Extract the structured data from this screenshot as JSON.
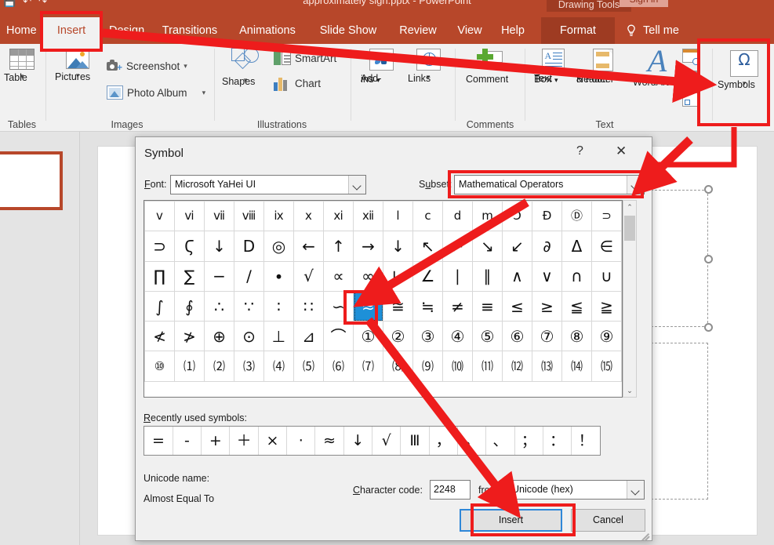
{
  "app": {
    "titlebar": {
      "document_title": "approximately sign.pptx  -  PowerPoint",
      "contextual_tools": "Drawing Tools",
      "signin": "Sign in",
      "qat_icons": [
        "save-icon",
        "undo-icon",
        "redo-icon"
      ]
    },
    "tabs": [
      {
        "label": "Home",
        "active": false
      },
      {
        "label": "Insert",
        "active": true
      },
      {
        "label": "Design",
        "active": false
      },
      {
        "label": "Transitions",
        "active": false
      },
      {
        "label": "Animations",
        "active": false
      },
      {
        "label": "Slide Show",
        "active": false
      },
      {
        "label": "Review",
        "active": false
      },
      {
        "label": "View",
        "active": false
      },
      {
        "label": "Help",
        "active": false
      },
      {
        "label": "Format",
        "active": false,
        "contextual": true
      }
    ],
    "tell_me": "Tell me",
    "ribbon_groups": [
      {
        "name": "Tables",
        "buttons": [
          {
            "label": "Table",
            "icon": "table-icon",
            "has_caret": true
          }
        ]
      },
      {
        "name": "Images",
        "buttons": [
          {
            "label": "Pictures",
            "icon": "pictures-icon",
            "has_caret": true
          },
          {
            "label": "Screenshot",
            "icon": "screenshot-icon",
            "has_caret": true
          },
          {
            "label": "Photo Album",
            "icon": "photo-album-icon",
            "has_caret": true
          }
        ]
      },
      {
        "name": "Illustrations",
        "buttons": [
          {
            "label": "Shapes",
            "icon": "shapes-icon",
            "has_caret": true
          },
          {
            "label": "SmartArt",
            "icon": "smartart-icon",
            "has_caret": false
          },
          {
            "label": "Chart",
            "icon": "chart-icon",
            "has_caret": false
          }
        ]
      },
      {
        "name": "",
        "buttons": [
          {
            "label": "Add-\nins",
            "icon": "add-ins-icon",
            "has_caret": true
          },
          {
            "label": "Links",
            "icon": "links-icon",
            "has_caret": true
          }
        ]
      },
      {
        "name": "Comments",
        "buttons": [
          {
            "label": "Comment",
            "icon": "comment-icon",
            "has_caret": false
          }
        ]
      },
      {
        "name": "Text",
        "buttons": [
          {
            "label": "Text\nBox",
            "icon": "text-box-icon",
            "has_caret": true
          },
          {
            "label": "Header\n& Footer",
            "icon": "header-footer-icon",
            "has_caret": false
          },
          {
            "label": "WordArt",
            "icon": "wordart-icon",
            "has_caret": true
          }
        ]
      },
      {
        "name": "",
        "buttons": [
          {
            "label": "Symbols",
            "icon": "omega-icon",
            "has_caret": true
          }
        ]
      }
    ],
    "ribbon_labels": {
      "table": "Table",
      "pictures": "Pictures",
      "screenshot": "Screenshot",
      "photo_album": "Photo Album",
      "shapes": "Shapes",
      "smartart": "SmartArt",
      "chart": "Chart",
      "addins": "Add-",
      "addins2": "ins",
      "links": "Links",
      "comment": "Comment",
      "textbox": "Text",
      "textbox2": "Box",
      "headerfooter": "Header",
      "headerfooter2": "& Footer",
      "wordart": "WordArt",
      "symbols": "Symbols",
      "omega_glyph": "Ω",
      "group_tables": "Tables",
      "group_images": "Images",
      "group_illustrations": "Illustrations",
      "group_comments": "Comments",
      "group_text": "Text"
    }
  },
  "dialog": {
    "title": "Symbol",
    "help_glyph": "?",
    "close_glyph": "✕",
    "font_label": "Font:",
    "font_label_parts": {
      "pre": "F",
      "u": "o",
      "post": "nt:"
    },
    "font_value": "Microsoft YaHei UI",
    "subset_label": "Subset:",
    "subset_value": "Mathematical Operators",
    "recent_label": "Recently used symbols:",
    "unicode_name_label": "Unicode name:",
    "unicode_name_value": "Almost Equal To",
    "char_code_label": "Character code:",
    "char_code_value": "2248",
    "from_label": "from:",
    "from_value": "Unicode (hex)",
    "insert_button": "Insert",
    "cancel_button": "Cancel",
    "selected_symbol": "≈",
    "scroll_up_glyph": "⌃",
    "scroll_down_glyph": "⌄",
    "symbol_grid": {
      "columns": 16,
      "selected_row": 3,
      "selected_col": 6,
      "rows": [
        [
          "ⅴ",
          "ⅵ",
          "ⅶ",
          "ⅷ",
          "ⅸ",
          "ⅹ",
          "ⅺ",
          "ⅻ",
          "ⅼ",
          "ⅽ",
          "ⅾ",
          "ⅿ",
          "Ↄ",
          "Ð",
          "Ⓓ",
          "⊃"
        ],
        [
          "⊃",
          "Ϛ",
          "↓",
          "Ⅾ",
          "◎",
          "←",
          "↑",
          "→",
          "↓",
          "↖",
          "↗",
          "↘",
          "↙",
          "∂",
          "Δ",
          "∈"
        ],
        [
          "∏",
          "∑",
          "−",
          "∕",
          "∙",
          "√",
          "∝",
          "∞",
          "∟",
          "∠",
          "∣",
          "∥",
          "∧",
          "∨",
          "∩",
          "∪"
        ],
        [
          "∫",
          "∮",
          "∴",
          "∵",
          "∶",
          "∷",
          "∽",
          "≈",
          "≅",
          "≒",
          "≠",
          "≡",
          "≤",
          "≥",
          "≦",
          "≧"
        ],
        [
          "≮",
          "≯",
          "⊕",
          "⊙",
          "⊥",
          "⊿",
          "⌒",
          "①",
          "②",
          "③",
          "④",
          "⑤",
          "⑥",
          "⑦",
          "⑧",
          "⑨"
        ],
        [
          "⑩",
          "⑴",
          "⑵",
          "⑶",
          "⑷",
          "⑸",
          "⑹",
          "⑺",
          "⑻",
          "⑼",
          "⑽",
          "⑾",
          "⑿",
          "⒀",
          "⒁",
          "⒂"
        ]
      ]
    },
    "recent_symbols": [
      "=",
      "-",
      "+",
      "＋",
      "×",
      "·",
      "≈",
      "↓",
      "√",
      "Ⅲ",
      "，",
      "。",
      "、",
      "；",
      "：",
      "！"
    ]
  },
  "annotations": {
    "red_boxes": [
      {
        "name": "insert-tab-highlight"
      },
      {
        "name": "subset-dropdown-highlight"
      },
      {
        "name": "symbols-button-highlight"
      },
      {
        "name": "selected-symbol-highlight"
      },
      {
        "name": "insert-button-highlight"
      }
    ],
    "arrows": [
      {
        "name": "arrow-insert-to-symbols"
      },
      {
        "name": "arrow-symbols-to-subset"
      },
      {
        "name": "arrow-subset-to-symbol"
      },
      {
        "name": "arrow-symbol-to-insert"
      }
    ],
    "accent_color": "#ee1c1c"
  },
  "colors": {
    "ribbon_red": "#b7472a",
    "contextual_red": "#9e3b22",
    "selection_blue": "#1e90d8",
    "annotation_red": "#ee1c1c"
  }
}
